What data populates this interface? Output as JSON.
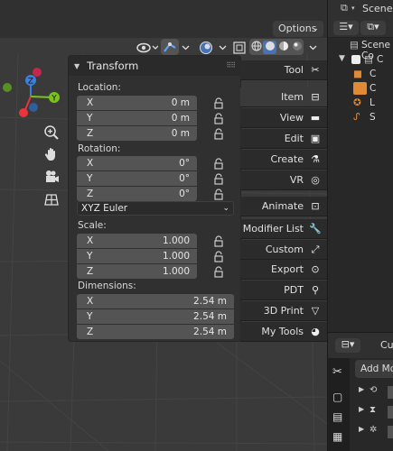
{
  "header": {
    "options_label": "Options",
    "options_chevron": "⌄"
  },
  "panel": {
    "title": "Transform",
    "location_label": "Location:",
    "location": [
      {
        "axis": "X",
        "value": "0 m"
      },
      {
        "axis": "Y",
        "value": "0 m"
      },
      {
        "axis": "Z",
        "value": "0 m"
      }
    ],
    "rotation_label": "Rotation:",
    "rotation": [
      {
        "axis": "X",
        "value": "0°"
      },
      {
        "axis": "Y",
        "value": "0°"
      },
      {
        "axis": "Z",
        "value": "0°"
      }
    ],
    "rotation_mode": "XYZ Euler",
    "scale_label": "Scale:",
    "scale": [
      {
        "axis": "X",
        "value": "1.000"
      },
      {
        "axis": "Y",
        "value": "1.000"
      },
      {
        "axis": "Z",
        "value": "1.000"
      }
    ],
    "dimensions_label": "Dimensions:",
    "dimensions": [
      {
        "axis": "X",
        "value": "2.54 m"
      },
      {
        "axis": "Y",
        "value": "2.54 m"
      },
      {
        "axis": "Z",
        "value": "2.54 m"
      }
    ]
  },
  "gizmo": {
    "z": "Z",
    "y": "Y"
  },
  "sidebar_tabs": [
    {
      "label": "Tool",
      "icon": "tool-icon"
    },
    {
      "label": "Item",
      "icon": "item-icon"
    },
    {
      "label": "View",
      "icon": "view-icon"
    },
    {
      "label": "Edit",
      "icon": "edit-icon"
    },
    {
      "label": "Create",
      "icon": "create-icon"
    },
    {
      "label": "VR",
      "icon": "vr-icon"
    },
    {
      "label": "Animate",
      "icon": "animate-icon"
    },
    {
      "label": "Modifier List",
      "icon": "wrench-icon"
    },
    {
      "label": "Custom",
      "icon": "custom-icon"
    },
    {
      "label": "Export",
      "icon": "export-icon"
    },
    {
      "label": "PDT",
      "icon": "pdt-icon"
    },
    {
      "label": "3D Print",
      "icon": "print-icon"
    },
    {
      "label": "My Tools",
      "icon": "globe-icon"
    }
  ],
  "outliner": {
    "scene_label": "Scene",
    "collection_label": "Scene Co",
    "rows": [
      "C",
      "C",
      "C",
      "L",
      "S"
    ]
  },
  "properties": {
    "add_modifier_label": "Add Modi",
    "header_label": "Cu"
  },
  "colors": {
    "accent": "#4772b3",
    "axis_x": "#e8343a",
    "axis_y": "#7bc21c",
    "axis_z": "#3b7fe0",
    "object_orange": "#e08a35"
  }
}
